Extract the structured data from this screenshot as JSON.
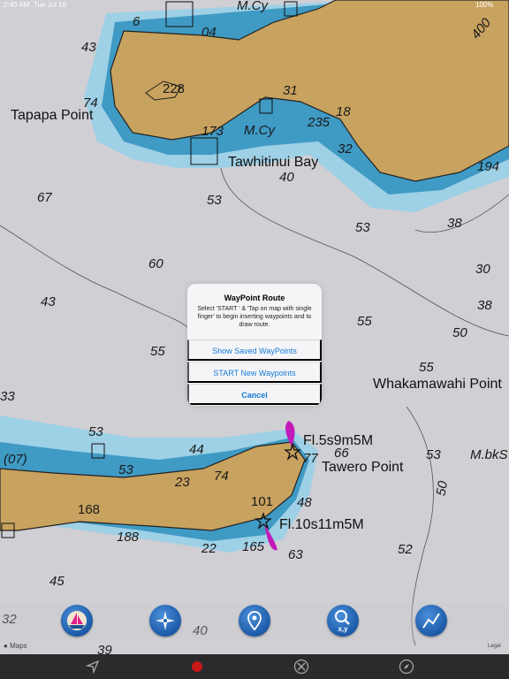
{
  "status_bar": {
    "time": "2:40 AM",
    "date": "Tue Jul 16",
    "battery": "100%"
  },
  "map": {
    "place_names": {
      "tapapa_point": "Tapapa Point",
      "tawhitinui_bay": "Tawhitinui Bay",
      "whakamawahi_point": "Whakamawahi Point",
      "tawero_point": "Tawero Point",
      "m_cy_top": "M.Cy",
      "m_cy_mid": "M.Cy",
      "m_bks": "M.bkS"
    },
    "light_labels": {
      "light_1": "Fl.5s9m5M",
      "light_2": "Fl.10s11m5M"
    },
    "heights": {
      "h228": "228",
      "h168": "168",
      "h101": "101",
      "h400": "400"
    },
    "soundings": {
      "s43a": "43",
      "s6": "6",
      "s04": "04",
      "s74": "74",
      "s31": "31",
      "s18": "18",
      "s235": "235",
      "s173": "173",
      "s32": "32",
      "s194": "194",
      "s40a": "40",
      "s67": "67",
      "s53a": "53",
      "s53b": "53",
      "s38a": "38",
      "s30": "30",
      "s60": "60",
      "s43b": "43",
      "s38b": "38",
      "s55a": "55",
      "s50a": "50",
      "s55b": "55",
      "s55c": "55",
      "s33": "33",
      "s53c": "53",
      "s44": "44",
      "s07": "(07)",
      "s53d": "53",
      "s23": "23",
      "s74b": "74",
      "s77": "77",
      "s66": "66",
      "s53e": "53",
      "s50b": "50",
      "s48": "48",
      "s188": "188",
      "s22": "22",
      "s165": "165",
      "s63": "63",
      "s52": "52",
      "s45": "45",
      "s32b": "32",
      "s40b": "40",
      "s39": "39"
    }
  },
  "dialog": {
    "title": "WayPoint Route",
    "message": "Select 'START ' & 'Tap on map with single finger' to begin inserting waypoints and to draw route.",
    "buttons": {
      "show_saved": "Show Saved WayPoints",
      "start_new": "START New Waypoints",
      "cancel": "Cancel"
    }
  },
  "toolbar": {
    "tools": [
      "boat-icon",
      "compass-icon",
      "map-pin-icon",
      "search-xy-icon",
      "route-icon"
    ],
    "search_label": "x,y"
  },
  "attribution": {
    "maps": "Maps",
    "legal": "Legal"
  },
  "tab_bar": {
    "tabs": [
      "navigation-arrow-icon",
      "record-icon",
      "tools-icon",
      "compass-icon"
    ]
  },
  "colors": {
    "land": "#c8a25f",
    "shallow_dark": "#3f9ac4",
    "shallow_light": "#9ed0e6",
    "deep": "#cfcfd4",
    "light_flare": "#c21ab8",
    "accent": "#1479d8"
  }
}
